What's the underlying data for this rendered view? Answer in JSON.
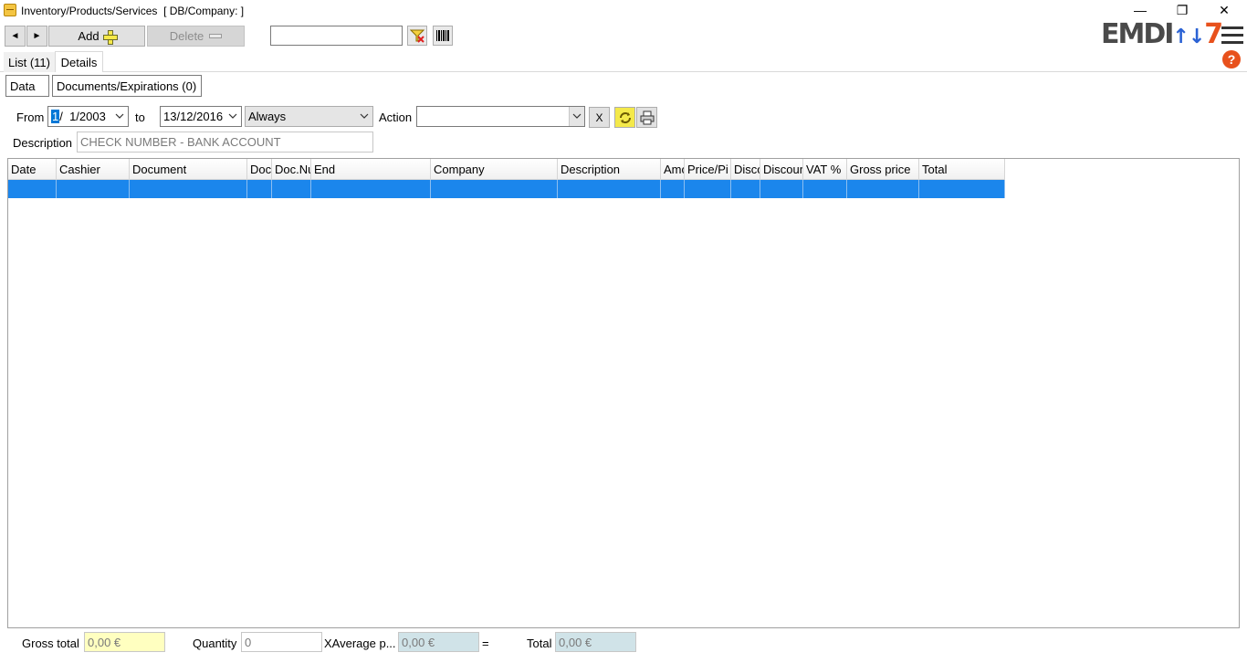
{
  "window": {
    "title": "Inventory/Products/Services  [ DB/Company: ]",
    "minimize_glyph": "—",
    "restore_glyph": "❐",
    "close_glyph": "✕"
  },
  "toolbar": {
    "prev_glyph": "◄",
    "next_glyph": "►",
    "add_label": "Add",
    "delete_label": "Delete",
    "search_value": "",
    "filter_icon": "filter-clear-icon",
    "barcode_icon": "barcode-icon"
  },
  "logo": {
    "part1": "EMDI",
    "arrows": "↑↓",
    "part2": "7"
  },
  "help_glyph": "?",
  "tabs": [
    {
      "label": "List (11)",
      "active": false
    },
    {
      "label": "Details",
      "active": true
    }
  ],
  "subtabs": [
    {
      "label": "Data"
    },
    {
      "label": "Documents/Expirations (0)"
    }
  ],
  "filter": {
    "from_label": "From",
    "from_day": "1",
    "from_rest": "/  1/2003",
    "to_label": "to",
    "to_value": "13/12/2016",
    "period_value": "Always",
    "action_label": "Action",
    "action_value": "",
    "clear_label": "X",
    "description_label": "Description",
    "description_placeholder": "CHECK NUMBER - BANK ACCOUNT"
  },
  "grid": {
    "columns": [
      "Date",
      "Cashier",
      "Document",
      "Doc",
      "Doc.Nu",
      "End",
      "Company",
      "Description",
      "Amo",
      "Price/Pi",
      "Disco",
      "Discour",
      "VAT %",
      "Gross price",
      "Total"
    ],
    "rows": [
      [
        "",
        "",
        "",
        "",
        "",
        "",
        "",
        "",
        "",
        "",
        "",
        "",
        "",
        "",
        ""
      ]
    ]
  },
  "footer": {
    "gross_total_label": "Gross total",
    "gross_total_value": "0,00 €",
    "quantity_label": "Quantity",
    "quantity_value": "0",
    "avg_label": "XAverage p...",
    "avg_value": "0,00 €",
    "equals": "=",
    "total_label": "Total",
    "total_value": "0,00 €"
  },
  "colors": {
    "selection": "#1b86ec",
    "gross_total_bg": "#ffffc0",
    "readonly_bg": "#d0e3e8",
    "accent": "#e8511c"
  }
}
